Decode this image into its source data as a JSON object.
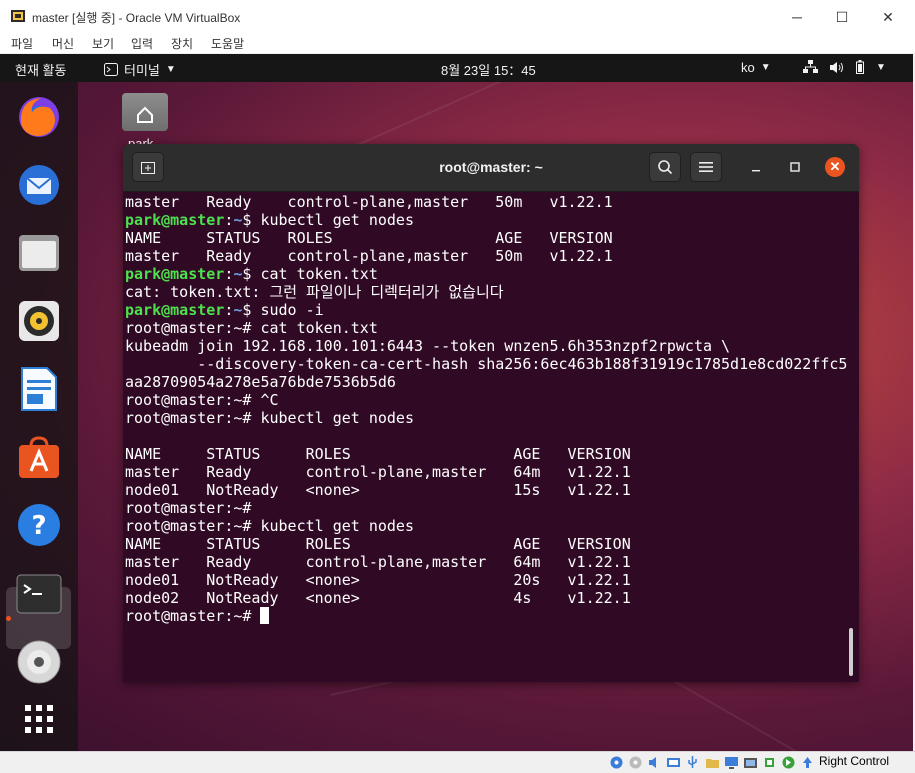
{
  "host_window": {
    "title": "master [실행 중] - Oracle VM VirtualBox",
    "controls": {
      "minimize": "─",
      "maximize": "☐",
      "close": "✕"
    },
    "menu": [
      "파일",
      "머신",
      "보기",
      "입력",
      "장치",
      "도움말"
    ],
    "status_right_label": "Right Control"
  },
  "gnome": {
    "activities": "현재 활동",
    "app_menu": "터미널",
    "clock": "8월 23일  15：45",
    "lang": "ko"
  },
  "desktop": {
    "home_icon_label": "park"
  },
  "dock": [
    "firefox-icon",
    "thunderbird-icon",
    "files-icon",
    "rhythmbox-icon",
    "writer-icon",
    "software-icon",
    "help-icon",
    "terminal-icon",
    "dvd-icon",
    "app-grid-icon"
  ],
  "terminal": {
    "title": "root@master: ~",
    "lines": [
      {
        "type": "out",
        "text": "master   Ready    control-plane,master   50m   v1.22.1"
      },
      {
        "type": "prompt",
        "user": "park@master",
        "sep": ":",
        "dir": "~",
        "sym": "$ ",
        "cmd": "kubectl get nodes"
      },
      {
        "type": "out",
        "text": "NAME     STATUS   ROLES                  AGE   VERSION"
      },
      {
        "type": "out",
        "text": "master   Ready    control-plane,master   50m   v1.22.1"
      },
      {
        "type": "prompt",
        "user": "park@master",
        "sep": ":",
        "dir": "~",
        "sym": "$ ",
        "cmd": "cat token.txt"
      },
      {
        "type": "out",
        "text": "cat: token.txt: 그런 파일이나 디렉터리가 없습니다"
      },
      {
        "type": "prompt",
        "user": "park@master",
        "sep": ":",
        "dir": "~",
        "sym": "$ ",
        "cmd": "sudo -i"
      },
      {
        "type": "out",
        "text": "root@master:~# cat token.txt"
      },
      {
        "type": "out",
        "text": "kubeadm join 192.168.100.101:6443 --token wnzen5.6h353nzpf2rpwcta \\"
      },
      {
        "type": "out",
        "text": "        --discovery-token-ca-cert-hash sha256:6ec463b188f31919c1785d1e8cd022ffc5"
      },
      {
        "type": "out",
        "text": "aa28709054a278e5a76bde7536b5d6"
      },
      {
        "type": "out",
        "text": "root@master:~# ^C"
      },
      {
        "type": "out",
        "text": "root@master:~# kubectl get nodes"
      },
      {
        "type": "out",
        "text": ""
      },
      {
        "type": "out",
        "text": "NAME     STATUS     ROLES                  AGE   VERSION"
      },
      {
        "type": "out",
        "text": "master   Ready      control-plane,master   64m   v1.22.1"
      },
      {
        "type": "out",
        "text": "node01   NotReady   <none>                 15s   v1.22.1"
      },
      {
        "type": "out",
        "text": "root@master:~#"
      },
      {
        "type": "out",
        "text": "root@master:~# kubectl get nodes"
      },
      {
        "type": "out",
        "text": "NAME     STATUS     ROLES                  AGE   VERSION"
      },
      {
        "type": "out",
        "text": "master   Ready      control-plane,master   64m   v1.22.1"
      },
      {
        "type": "out",
        "text": "node01   NotReady   <none>                 20s   v1.22.1"
      },
      {
        "type": "out",
        "text": "node02   NotReady   <none>                 4s    v1.22.1"
      },
      {
        "type": "cursor",
        "text": "root@master:~# "
      }
    ]
  },
  "colors": {
    "terminal_bg": "#300a24",
    "prompt_user": "#4ee04e",
    "prompt_dir": "#6f9ee3",
    "ubuntu_orange": "#e95420"
  }
}
